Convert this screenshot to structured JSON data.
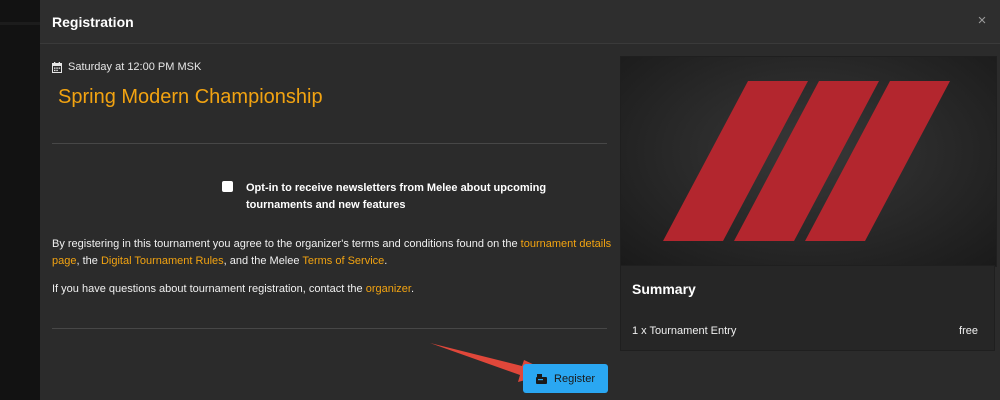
{
  "modal": {
    "title": "Registration",
    "close_label": "×"
  },
  "event": {
    "date_icon": "calendar-icon",
    "date": "Saturday at 12:00 PM MSK",
    "name": "Spring Modern Championship"
  },
  "newsletter": {
    "checked": false,
    "label": "Opt-in to receive newsletters from Melee about upcoming tournaments and new features"
  },
  "terms": {
    "text_1": "By registering in this tournament you agree to the organizer's terms and conditions found on the ",
    "link_1": "tournament details page",
    "text_2": ", the ",
    "link_2": "Digital Tournament Rules",
    "text_3": ", and the Melee ",
    "link_3": "Terms of Service",
    "text_4": "."
  },
  "contact": {
    "text_1": "If you have questions about tournament registration, contact the ",
    "link": "organizer",
    "text_2": "."
  },
  "summary": {
    "title": "Summary",
    "item_label": "1 x Tournament Entry",
    "item_value": "free"
  },
  "register_button": {
    "icon": "register-icon",
    "label": "Register"
  },
  "colors": {
    "accent": "#f2a311",
    "button": "#2aa7f2",
    "logo_stripes": "#b3262e",
    "annotation_arrow": "#e0473a"
  }
}
